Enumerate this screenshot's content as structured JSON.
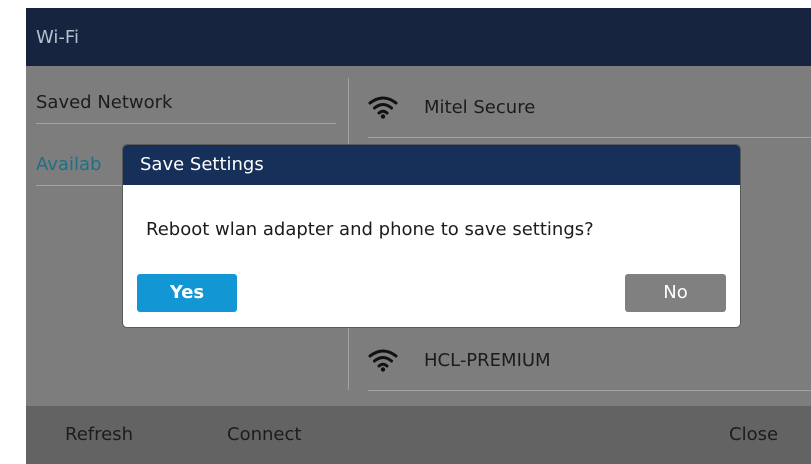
{
  "window": {
    "title": "Wi-Fi"
  },
  "left_panel": {
    "items": [
      {
        "label": "Saved Network"
      },
      {
        "label": "Availab"
      }
    ]
  },
  "networks": [
    {
      "name": "Mitel Secure",
      "icon": "wifi-icon"
    },
    {
      "name": "HCL-PREMIUM",
      "icon": "wifi-icon"
    }
  ],
  "softkeys": {
    "refresh": "Refresh",
    "connect": "Connect",
    "close": "Close"
  },
  "dialog": {
    "title": "Save Settings",
    "message": "Reboot wlan adapter and phone to save settings?",
    "yes_label": "Yes",
    "no_label": "No"
  },
  "colors": {
    "title_bar": "#16243f",
    "dialog_title_bar": "#16305a",
    "primary_button": "#1297d4",
    "secondary_button": "#808080",
    "overlay_background": "#7d7d7d",
    "active_left_item": "#1f6f86"
  }
}
